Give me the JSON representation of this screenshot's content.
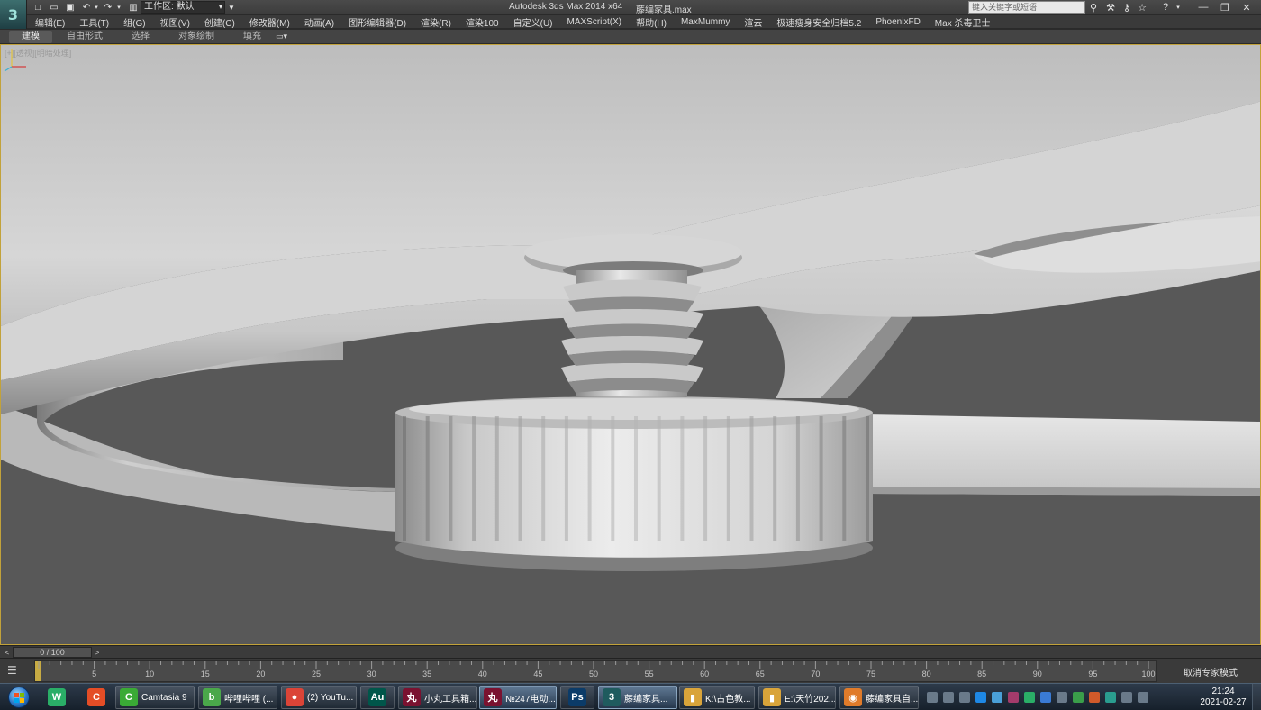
{
  "app": {
    "logo_glyph": "3",
    "title": "Autodesk 3ds Max  2014 x64",
    "file_name": "藤编家具.max",
    "workspace_label": "工作区: 默认",
    "search_placeholder": "键入关键字或短语"
  },
  "quick_access": {
    "icons": [
      "new-file-icon",
      "open-file-icon",
      "save-icon",
      "undo-icon",
      "redo-icon"
    ]
  },
  "title_icons": [
    "binoculars-icon",
    "wrench-icon",
    "key-icon",
    "star-icon",
    "help-icon"
  ],
  "window_controls": [
    "minimize-icon",
    "restore-icon",
    "close-icon"
  ],
  "menu": [
    "编辑(E)",
    "工具(T)",
    "组(G)",
    "视图(V)",
    "创建(C)",
    "修改器(M)",
    "动画(A)",
    "图形编辑器(D)",
    "渲染(R)",
    "渲染100",
    "自定义(U)",
    "MAXScript(X)",
    "帮助(H)",
    "MaxMummy",
    "渲云",
    "极速瘦身安全归档5.2",
    "PhoenixFD",
    "Max 杀毒卫士"
  ],
  "ribbon": {
    "tabs": [
      "建模",
      "自由形式",
      "选择",
      "对象绘制",
      "填充"
    ],
    "active_index": 0
  },
  "viewport": {
    "label": "[+][透视][明暗处理]",
    "border_color": "#c2a23a",
    "background_color": "#585858"
  },
  "timeline": {
    "frame_label": "0 / 100",
    "prev_glyph": "<",
    "next_glyph": ">"
  },
  "trackbar": {
    "ticks": [
      5,
      10,
      15,
      20,
      25,
      30,
      35,
      40,
      45,
      50,
      55,
      60,
      65,
      70,
      75,
      80,
      85,
      90,
      95,
      100
    ],
    "max_frame": 100,
    "expert_mode_label": "取消专家模式"
  },
  "taskbar": {
    "pinned": [
      {
        "name": "wechat-icon",
        "color": "#2aae67",
        "glyph": "W"
      },
      {
        "name": "camtasia-recorder-icon",
        "color": "#e44d26",
        "glyph": "C"
      }
    ],
    "items": [
      {
        "label": "Camtasia 9",
        "icon": "camtasia-icon",
        "color": "#3aaa35",
        "glyph": "C",
        "active": false
      },
      {
        "label": "哔哩哔哩 (...",
        "icon": "bilibili-icon",
        "color": "#4aa84a",
        "glyph": "b",
        "active": false
      },
      {
        "label": "(2) YouTu...",
        "icon": "chrome-icon",
        "color": "#db4437",
        "glyph": "●",
        "active": false
      },
      {
        "label": "",
        "icon": "audition-icon",
        "color": "#00564a",
        "glyph": "Au",
        "active": false
      },
      {
        "label": "小丸工具箱...",
        "icon": "xiaowan-icon",
        "color": "#7a1230",
        "glyph": "丸",
        "active": false
      },
      {
        "label": "№247电动...",
        "icon": "xiaowan-icon",
        "color": "#7a1230",
        "glyph": "丸",
        "active": true
      },
      {
        "label": "",
        "icon": "photoshop-icon",
        "color": "#0b3b68",
        "glyph": "Ps",
        "active": false
      },
      {
        "label": "藤编家具...",
        "icon": "3dsmax-icon",
        "color": "#1f5b5e",
        "glyph": "3",
        "active": true
      },
      {
        "label": "K:\\古色教...",
        "icon": "folder-icon",
        "color": "#d9a43a",
        "glyph": "▮",
        "active": false
      },
      {
        "label": "E:\\天竹202...",
        "icon": "folder-icon",
        "color": "#d9a43a",
        "glyph": "▮",
        "active": false
      },
      {
        "label": "藤编家具自...",
        "icon": "camera-app-icon",
        "color": "#e07b2a",
        "glyph": "◉",
        "active": false
      }
    ],
    "tray": [
      {
        "name": "keyboard-icon",
        "color": "#6a7a8a"
      },
      {
        "name": "network-icon",
        "color": "#6a7a8a"
      },
      {
        "name": "bluetooth-icon",
        "color": "#6a7a8a"
      },
      {
        "name": "qq-icon",
        "color": "#1e88e5"
      },
      {
        "name": "app-tray-icon",
        "color": "#4aa0d8"
      },
      {
        "name": "app-tray-icon",
        "color": "#a33b6b"
      },
      {
        "name": "wechat-tray-icon",
        "color": "#2aae67"
      },
      {
        "name": "sync-icon",
        "color": "#3a7bd5"
      },
      {
        "name": "battery-icon",
        "color": "#6a7a8a"
      },
      {
        "name": "app-tray-icon",
        "color": "#3a9e4a"
      },
      {
        "name": "shield-icon",
        "color": "#d05a2a"
      },
      {
        "name": "app-tray-icon",
        "color": "#2a9d8f"
      },
      {
        "name": "speaker-icon",
        "color": "#6a7a8a"
      },
      {
        "name": "flag-icon",
        "color": "#6a7a8a"
      }
    ],
    "time": "21:24",
    "date": "2021-02-27"
  }
}
